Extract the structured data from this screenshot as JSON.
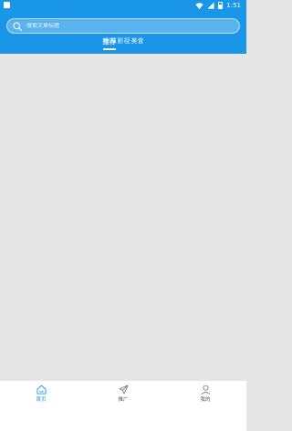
{
  "status_bar": {
    "time": "1:51"
  },
  "search": {
    "placeholder": "搜索文章标题"
  },
  "tabs": [
    {
      "label": "推荐",
      "active": true
    },
    {
      "label": "影视",
      "active": false
    },
    {
      "label": "美食",
      "active": false
    }
  ],
  "bottom_nav": [
    {
      "label": "首页",
      "icon": "home-icon",
      "active": true
    },
    {
      "label": "推广",
      "icon": "send-icon",
      "active": false
    },
    {
      "label": "我的",
      "icon": "user-icon",
      "active": false
    }
  ],
  "colors": {
    "primary": "#1a96e8",
    "background": "#e6e6e6",
    "nav_active": "#1a96e8",
    "nav_inactive": "#555555"
  }
}
